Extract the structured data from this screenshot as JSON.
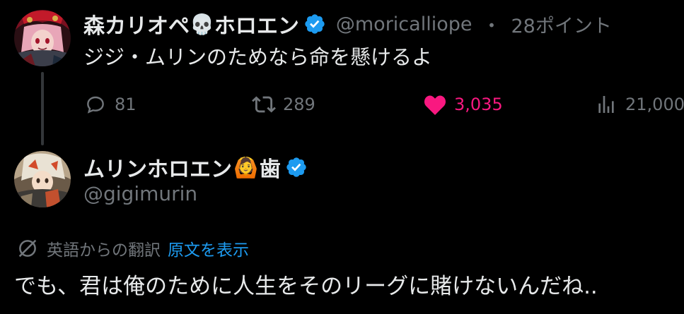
{
  "colors": {
    "background": "#000000",
    "text_primary": "#e7e9ea",
    "text_secondary": "#71767b",
    "verified": "#1d9bf0",
    "like": "#f91880",
    "link": "#1d9bf0",
    "thread_line": "#333639"
  },
  "tweet": {
    "author": {
      "display_name": "森カリオペ",
      "name_emoji": "💀",
      "display_name_suffix": "ホロエン",
      "handle": "@moricalliope",
      "separator": "・",
      "points": "28ポイント",
      "avatar_icon": "avatar-calliope"
    },
    "text": "ジジ・ムリンのためなら命を懸けるよ",
    "actions": {
      "replies": "81",
      "retweets": "289",
      "likes": "3,035",
      "views": "21,000"
    }
  },
  "reply": {
    "author": {
      "display_name": "ムリンホロエン",
      "name_emoji": "🙆",
      "name_suffix": "歯",
      "handle": "@gigimurin",
      "avatar_icon": "avatar-gigi"
    },
    "translation": {
      "label": "英語からの翻訳",
      "show_original": "原文を表示"
    },
    "text": "でも、君は俺のために人生をそのリーグに賭けないんだね.."
  }
}
